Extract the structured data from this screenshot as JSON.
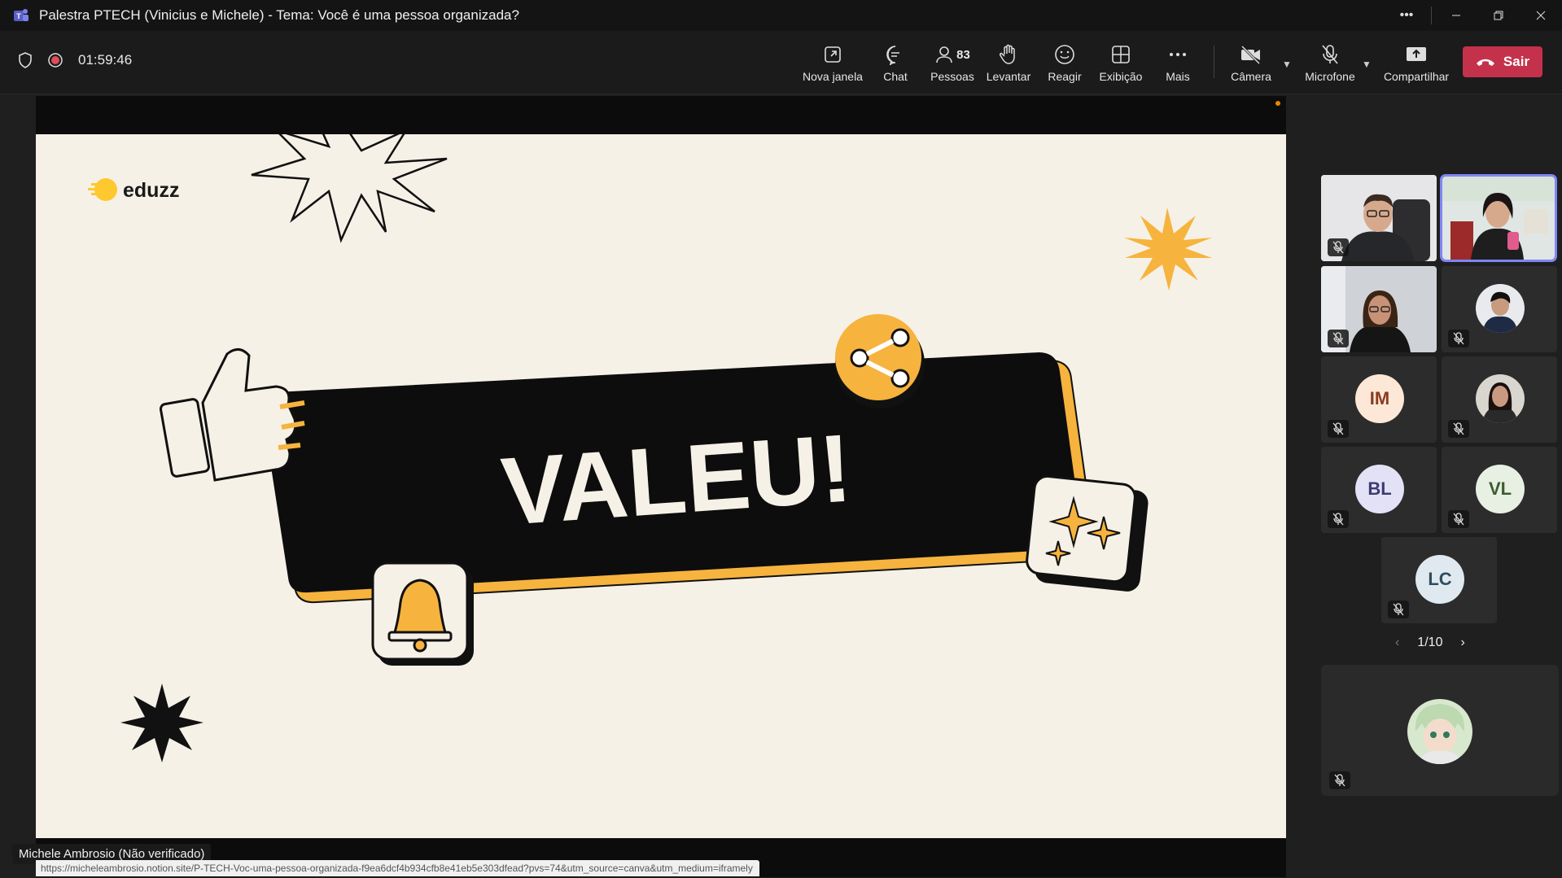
{
  "window": {
    "title": "Palestra PTECH (Vinicius e Michele) - Tema: Você é uma pessoa organizada?"
  },
  "toolbar": {
    "timer": "01:59:46",
    "people_count": "83",
    "buttons": {
      "new_window": "Nova janela",
      "chat": "Chat",
      "people": "Pessoas",
      "raise": "Levantar",
      "react": "Reagir",
      "view": "Exibição",
      "more": "Mais",
      "camera": "Câmera",
      "mic": "Microfone",
      "share": "Compartilhar",
      "leave": "Sair"
    }
  },
  "slide": {
    "brand": "eduzz",
    "headline": "VALEU!"
  },
  "speaker": {
    "name": "Michele Ambrosio (Não verificado)"
  },
  "url_bar": "https://micheleambrosio.notion.site/P-TECH-Voc-uma-pessoa-organizada-f9ea6dcf4b934cfb8e41eb5e303dfead?pvs=74&utm_source=canva&utm_medium=iframely",
  "participants": [
    {
      "initials": "IM",
      "color": "#fde8d8",
      "text_color": "#8a3b1e"
    },
    {
      "initials": "BL",
      "color": "#e3e1f5",
      "text_color": "#3e3a73"
    },
    {
      "initials": "VL",
      "color": "#e7f0e2",
      "text_color": "#3e5a31"
    },
    {
      "initials": "LC",
      "color": "#dfe9ef",
      "text_color": "#2f4d5e"
    }
  ],
  "pager": "1/10",
  "colors": {
    "leave": "#c4314b",
    "accent": "#f6b33e",
    "slide_bg": "#f6f1e7"
  }
}
